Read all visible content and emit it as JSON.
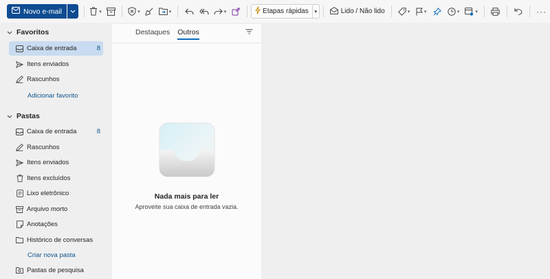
{
  "toolbar": {
    "new_mail_label": "Novo e-mail",
    "quick_steps_label": "Etapas rápidas",
    "read_unread_label": "Lido / Não lido"
  },
  "sidebar": {
    "favorites": {
      "title": "Favoritos",
      "items": [
        {
          "label": "Caixa de entrada",
          "count": "8",
          "icon": "inbox-icon",
          "selected": true
        },
        {
          "label": "Itens enviados",
          "count": "",
          "icon": "send-icon"
        },
        {
          "label": "Rascunhos",
          "count": "",
          "icon": "draft-icon"
        }
      ],
      "add_link": "Adicionar favorito"
    },
    "folders": {
      "title": "Pastas",
      "items": [
        {
          "label": "Caixa de entrada",
          "count": "8",
          "icon": "inbox-icon"
        },
        {
          "label": "Rascunhos",
          "count": "",
          "icon": "draft-icon"
        },
        {
          "label": "Itens enviados",
          "count": "",
          "icon": "send-icon"
        },
        {
          "label": "Itens excluídos",
          "count": "",
          "icon": "trash-icon"
        },
        {
          "label": "Lixo eletrônico",
          "count": "",
          "icon": "junk-icon"
        },
        {
          "label": "Arquivo morto",
          "count": "",
          "icon": "archive-icon"
        },
        {
          "label": "Anotações",
          "count": "",
          "icon": "notes-icon"
        },
        {
          "label": "Histórico de conversas",
          "count": "",
          "icon": "folder-icon"
        }
      ],
      "create_link": "Criar nova pasta",
      "search_folders": {
        "label": "Pastas de pesquisa",
        "icon": "search-folder-icon"
      }
    }
  },
  "message_list": {
    "tabs": [
      {
        "label": "Destaques",
        "active": false
      },
      {
        "label": "Outros",
        "active": true
      }
    ],
    "empty_title": "Nada mais para ler",
    "empty_subtitle": "Aproveite sua caixa de entrada vazia."
  },
  "colors": {
    "accent": "#0f4c92",
    "selected_bg": "#c9dbf0",
    "link": "#0f548c"
  }
}
